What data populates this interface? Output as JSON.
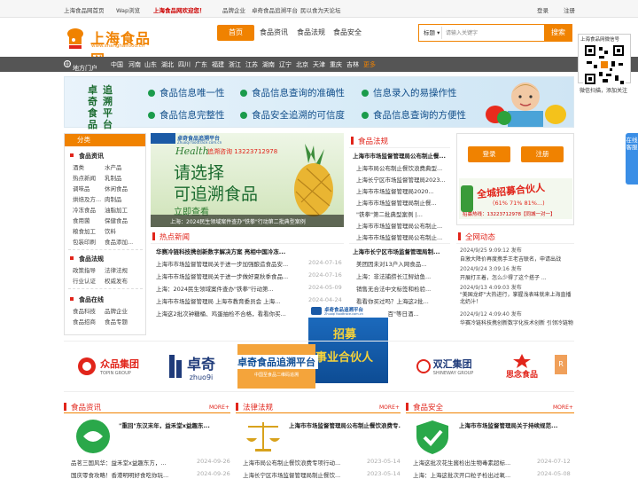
{
  "topbar": {
    "home": "上海食品网首页",
    "wap": "Wap浏览",
    "welcome": "上海食品网欢迎您！",
    "brand": "品牌企业",
    "trace": "卓奇食品追溯平台",
    "chat": "民以食为天论坛",
    "login": "登录",
    "register": "注册"
  },
  "logo": {
    "cn": "上海食品网",
    "en": "www.shanghaifood.cn"
  },
  "nav": {
    "home": "首页",
    "news": "食品资讯",
    "law": "食品法规",
    "safety": "食品安全"
  },
  "search": {
    "select": "标题",
    "placeholder": "请输入关键字",
    "button": "搜索"
  },
  "regionbar": {
    "label": "地方门户",
    "items": [
      "中国",
      "河南",
      "山东",
      "湖北",
      "四川",
      "广东",
      "福建",
      "浙江",
      "江苏",
      "湖南",
      "辽宁",
      "北京",
      "天津",
      "重庆",
      "吉林"
    ],
    "more": "更多"
  },
  "banner": {
    "side": [
      "卓奇食品",
      "追溯平台"
    ],
    "texts": [
      "食品信息唯一性",
      "食品信息查询的准确性",
      "信息录入的易操作性",
      "食品信息完整性",
      "食品安全追溯的可信度",
      "食品信息查询的方便性"
    ]
  },
  "qr": {
    "title": "上海食品网微信号",
    "caption": "微信扫描，添加关注"
  },
  "float": {
    "online": "在线客服"
  },
  "category": {
    "header": "分类",
    "groups": [
      {
        "title": "食品资讯",
        "items": [
          "酒类",
          "水产品",
          "热点新闻",
          "乳制品",
          "调味品",
          "休闲食品",
          "烘焙及方...",
          "肉制品",
          "冷冻食品",
          "油脂加工",
          "食用菌",
          "保健食品",
          "粮食加工",
          "饮料",
          "包装印刷",
          "食品添加..."
        ]
      },
      {
        "title": "食品法规",
        "items": [
          "政策指导",
          "法律法规",
          "行业认证",
          "权威发布"
        ]
      },
      {
        "title": "食品在线",
        "items": [
          "食品科技",
          "品牌企业",
          "食品招商",
          "食品专题"
        ]
      }
    ]
  },
  "slider": {
    "site": "卓奇食品追溯平台",
    "siteen": "Zhuoqi foodtrace.com.cn",
    "health": "Health",
    "phone": "追溯咨询 13223712978",
    "line1": "请选择",
    "line2": "可追溯食品",
    "line3": "立即查看",
    "caption": "上海：2024民生领域案件查办\"铁拳\"行动第二批典型案例"
  },
  "hot": {
    "title": "热点新闻",
    "headline": "华赛冷链科技携创新数字解决方案 亮相中国冷冻...",
    "items": [
      {
        "t": "上海市市场监督管理局关于进一步加强酿造食品安...",
        "d": "2024-07-16"
      },
      {
        "t": "上海市市场监督管理局关于进一步做好夏秋季食品...",
        "d": "2024-07-16"
      },
      {
        "t": "上海：2024民生领域案件查办\"铁拳\"行动第...",
        "d": "2024-05-09"
      },
      {
        "t": "上海市市场监督管理局 上海市教育委员会 上海...",
        "d": "2024-04-24"
      },
      {
        "t": "上海这2批次钟糖桶、鸡蛋抽检不合格，看看你买...",
        "d": "2024-03-07"
      }
    ]
  },
  "law": {
    "title": "食品法规",
    "headline": "上海市市场监督管理局公布制止餐...",
    "items": [
      "上海市局公布制止餐饮浪费典型...",
      "上海长宁区市场监督管理局2023...",
      "上海市市场监督管理局2020...",
      "上海市市场监督管理局制止餐...",
      "\"铁拳\"第二批典型案例 |...",
      "上海市市场监督管理局公布制止...",
      "上海市市场监督管理局公布制止..."
    ],
    "headline2": "上海市长宁区市场监督管理局制...",
    "items2": [
      "美团因未对13户入网食品...",
      "上海：非法捕捞长江鲟幼鱼...",
      "销售无合法中文标签和检验...",
      "看看你买过吗？上海这2批...",
      "海底捞火锅\"百\"等日酒..."
    ]
  },
  "user": {
    "login": "登录",
    "register": "注册"
  },
  "ad": {
    "title": "全城招募合伙人",
    "pct": "（61% 71% 81%...)",
    "phone": "招募热线：13223712978【同城一对一】"
  },
  "dynamic": {
    "title": "全网动态",
    "items": [
      {
        "d": "2024/9/25 9:09:12 发布",
        "t": "自激大降价再度携手王老吉联名，申请出战"
      },
      {
        "d": "2024/9/24 3:09:16 发布",
        "t": "开展打王着，怎么少得了这个搭子 ..."
      },
      {
        "d": "2024/9/13 4:09:03 发布",
        "t": "\"美国龙虾\"大热进行，掌握浅表味就来上海直播北奶汁！"
      },
      {
        "d": "2024/9/12 4:09:40 发布",
        "t": "华赛冷链科技携创新数字化技术创新 引领冷链物流迈"
      }
    ]
  },
  "adpop": {
    "site": "卓奇食品追溯平台",
    "siteen": "Zhuoqi foodtrace.com.cn",
    "text": [
      "招募",
      "事业合伙人"
    ]
  },
  "logos": {
    "zhongpin": "众品集团",
    "zhongpin_en": "TOPIN GROUP",
    "zhuoqi": "卓奇",
    "zhuoqi_en": "zhuo9i",
    "trace": "卓奇食品追溯平台",
    "trace_sub": "中国至食品二维码追溯",
    "shuanghui": "双汇集团",
    "shuanghui_en": "SHINEWAY GROUP",
    "siniang": "思念食品"
  },
  "sections": [
    {
      "title": "食品资讯",
      "more": "MORE+",
      "headline": "\"重回\"东汉末年，益禾堂x益趣东...",
      "items": [
        {
          "t": "品茗三国风华：益禾堂x益趣东方，...",
          "d": "2024-09-26"
        },
        {
          "t": "国庆零食攻略！香港明明好食吃你玩...",
          "d": "2024-09-26"
        }
      ]
    },
    {
      "title": "法律法规",
      "more": "MORE+",
      "headline": "上海市市场监督管理局公布制止餐饮浪费专...",
      "items": [
        {
          "t": "上海市局公布制止餐饮浪费专项行动...",
          "d": "2023-05-14"
        },
        {
          "t": "上海长宁区市场监督管理局制止餐饮...",
          "d": "2023-05-14"
        }
      ]
    },
    {
      "title": "食品安全",
      "more": "MORE+",
      "headline": "上海市市场监督管理局关于持续规范...",
      "items": [
        {
          "t": "上海这批次花生酱检出生物毒素超标...",
          "d": "2024-07-12"
        },
        {
          "t": "上海：上海这批次开口粒子检出过氧...",
          "d": "2024-05-08"
        }
      ]
    }
  ]
}
